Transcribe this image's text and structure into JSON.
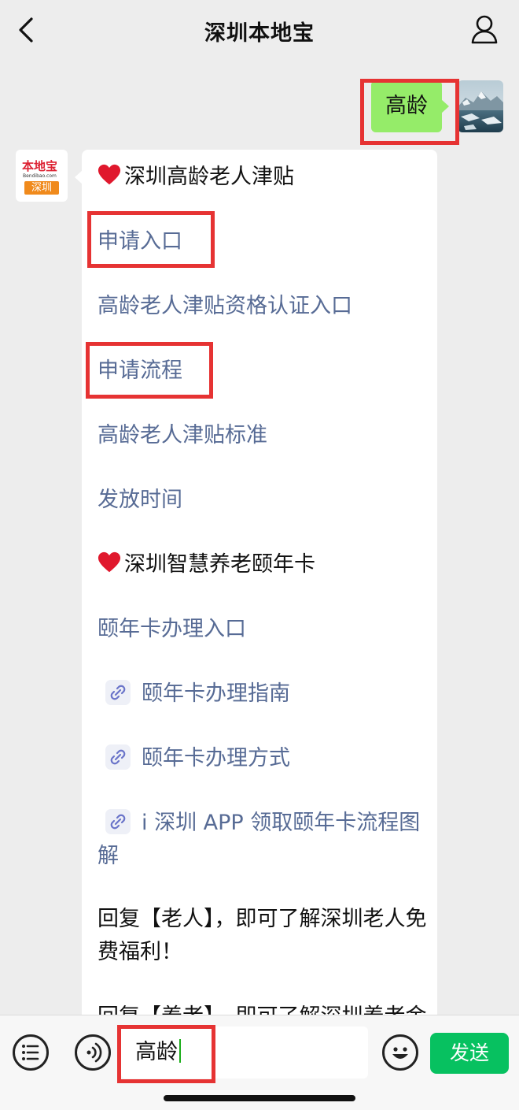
{
  "header": {
    "title": "深圳本地宝",
    "back_icon": "chevron-left-icon",
    "profile_icon": "person-icon"
  },
  "outgoing_message": {
    "text": "高龄"
  },
  "account_avatar": {
    "brand": "本地宝",
    "domain": "Bendibao.com",
    "city": "深圳"
  },
  "reply": {
    "lines": [
      {
        "text": "深圳高龄老人津贴",
        "type": "heading",
        "icon": "heart-icon"
      },
      {
        "text": "申请入口",
        "type": "link"
      },
      {
        "text": "高龄老人津贴资格认证入口",
        "type": "link"
      },
      {
        "text": "申请流程",
        "type": "link"
      },
      {
        "text": "高龄老人津贴标准",
        "type": "link"
      },
      {
        "text": "发放时间",
        "type": "link"
      },
      {
        "text": "深圳智慧养老颐年卡",
        "type": "heading",
        "icon": "heart-icon"
      },
      {
        "text": "颐年卡办理入口",
        "type": "link"
      },
      {
        "text": "颐年卡办理指南",
        "type": "mini-program-link",
        "icon": "mini-program-icon"
      },
      {
        "text": "颐年卡办理方式",
        "type": "mini-program-link",
        "icon": "mini-program-icon"
      },
      {
        "text": "i 深圳 APP 领取颐年卡流程图解",
        "type": "mini-program-link",
        "icon": "mini-program-icon"
      },
      {
        "text": "回复【老人】，即可了解深圳老人免费福利！",
        "type": "text"
      },
      {
        "text": "回复【养老】，即可了解深圳养老金",
        "type": "text"
      }
    ]
  },
  "input_bar": {
    "menu_icon": "list-menu-icon",
    "voice_icon": "voice-icon",
    "input_value": "高龄",
    "emoji_icon": "emoji-icon",
    "send_label": "发送"
  },
  "colors": {
    "background": "#ededed",
    "outgoing_bubble": "#95ec69",
    "link": "#576b95",
    "highlight": "#e63333",
    "send_button": "#07c160"
  }
}
